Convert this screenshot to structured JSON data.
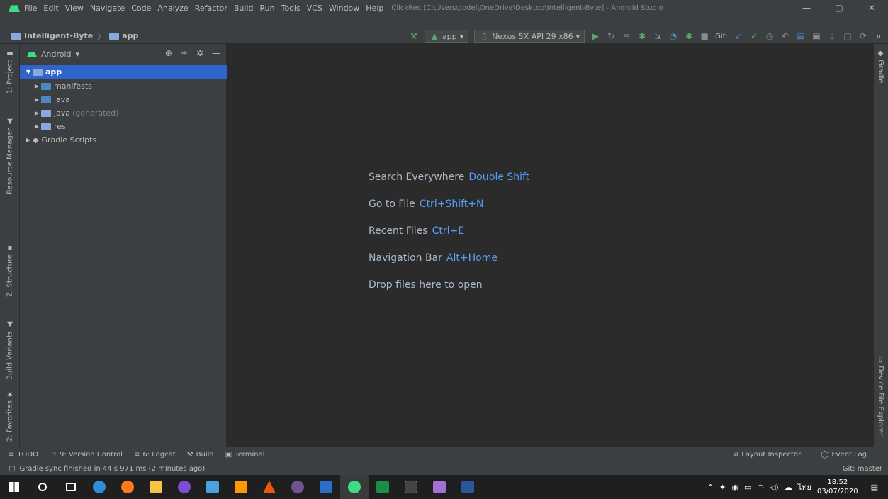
{
  "window": {
    "title": "ClickRec [C:\\Users\\codel\\OneDrive\\Desktop\\Intelligent-Byte] - Android Studio",
    "controls": [
      "—",
      "▢",
      "✕"
    ]
  },
  "menu": [
    "File",
    "Edit",
    "View",
    "Navigate",
    "Code",
    "Analyze",
    "Refactor",
    "Build",
    "Run",
    "Tools",
    "VCS",
    "Window",
    "Help"
  ],
  "breadcrumb": {
    "project": "Intelligent-Byte",
    "module": "app"
  },
  "toolbar": {
    "config": "app",
    "device": "Nexus 5X API 29 x86",
    "git_label": "Git:"
  },
  "project_panel": {
    "view_mode": "Android",
    "tree": [
      {
        "label": "app",
        "extra": ""
      },
      {
        "label": "manifests",
        "extra": ""
      },
      {
        "label": "java",
        "extra": ""
      },
      {
        "label": "java",
        "extra": "(generated)"
      },
      {
        "label": "res",
        "extra": ""
      },
      {
        "label": "Gradle Scripts",
        "extra": ""
      }
    ]
  },
  "left_tabs": [
    "1: Project",
    "Resource Manager",
    "Z: Structure",
    "Build Variants",
    "2: Favorites"
  ],
  "right_tabs": [
    "Gradle",
    "Device File Explorer"
  ],
  "editor_hints": [
    {
      "text": "Search Everywhere",
      "key": "Double Shift"
    },
    {
      "text": "Go to File",
      "key": "Ctrl+Shift+N"
    },
    {
      "text": "Recent Files",
      "key": "Ctrl+E"
    },
    {
      "text": "Navigation Bar",
      "key": "Alt+Home"
    },
    {
      "text": "Drop files here to open",
      "key": ""
    }
  ],
  "bottom_tools": {
    "todo": "TODO",
    "vcs": "9: Version Control",
    "logcat": "6: Logcat",
    "build": "Build",
    "terminal": "Terminal",
    "layout_inspector": "Layout Inspector",
    "event_log": "Event Log"
  },
  "status": {
    "message": "Gradle sync finished in 44 s 971 ms (2 minutes ago)",
    "git_branch": "Git: master"
  },
  "taskbar": {
    "lang": "ไทย",
    "time": "18:52",
    "date": "03/07/2020"
  },
  "colors": {
    "selection": "#2f65ca",
    "hint_key": "#589df6",
    "android_green": "#3ddc84"
  }
}
